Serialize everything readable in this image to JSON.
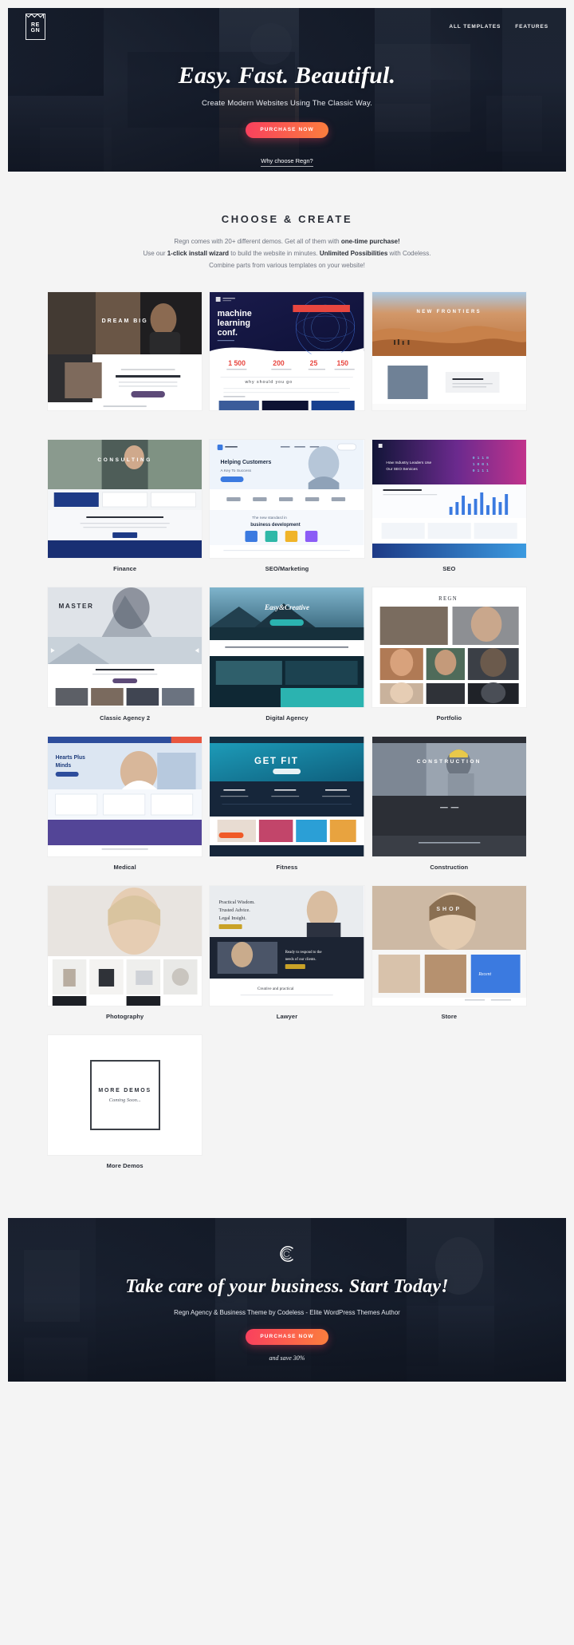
{
  "hero": {
    "logo": {
      "name": "regn-logo",
      "line1": "RE",
      "line2": "GN"
    },
    "nav": [
      {
        "label": "ALL TEMPLATES"
      },
      {
        "label": "FEATURES"
      }
    ],
    "title": "Easy. Fast. Beautiful.",
    "subtitle": "Create Modern Websites Using The Classic Way.",
    "cta_label": "PURCHASE NOW",
    "secondary_link": "Why choose Regn?",
    "accent_from": "#f9405e",
    "accent_to": "#fb7f3d",
    "overlay_color": "#111724"
  },
  "section": {
    "title": "CHOOSE & CREATE",
    "desc_line1_a": "Regn comes with 20+ different demos. Get all of them with ",
    "desc_line1_b": "one-time purchase!",
    "desc_line2_a": "Use our ",
    "desc_line2_b": "1-click install wizard",
    "desc_line2_c": " to build the website in minutes. ",
    "desc_line2_d": "Unlimited Possibilities",
    "desc_line2_e": " with Codeless.",
    "desc_line3": "Combine parts from various templates on your website!"
  },
  "templates": [
    {
      "label": "",
      "caption": "DREAM BIG",
      "style": "dream-big"
    },
    {
      "label": "",
      "caption": "machine learning conf.",
      "style": "ml-conf",
      "stats": [
        "1 500",
        "200",
        "25",
        "150"
      ],
      "note": "why should you go"
    },
    {
      "label": "",
      "caption": "NEW FRONTIERS",
      "style": "frontiers"
    },
    {
      "label": "Finance",
      "caption": "CONSULTING",
      "style": "finance"
    },
    {
      "label": "SEO/Marketing",
      "caption": "Helping Customers",
      "caption2": "A Key To Success",
      "caption3": "The new standard in",
      "caption4": "business development",
      "style": "seo-marketing"
    },
    {
      "label": "SEO",
      "caption": "How Industry Leaders Use Our SEO Services",
      "style": "seo"
    },
    {
      "label": "Classic Agency 2",
      "caption": "MASTER",
      "style": "classic-agency"
    },
    {
      "label": "Digital Agency",
      "caption": "Easy&Creative",
      "style": "digital-agency"
    },
    {
      "label": "Portfolio",
      "caption": "REGN",
      "style": "portfolio"
    },
    {
      "label": "Medical",
      "caption": "Hearts Plus Minds",
      "style": "medical"
    },
    {
      "label": "Fitness",
      "caption": "GET FIT",
      "style": "fitness"
    },
    {
      "label": "Construction",
      "caption": "CONSTRUCTION",
      "style": "construction"
    },
    {
      "label": "Photography",
      "caption": "",
      "style": "photography"
    },
    {
      "label": "Lawyer",
      "caption": "Practical Wisdom. Trusted Advice. Legal Insight.",
      "caption2": "Ready to respond to the needs of our clients.",
      "caption3": "Creative and practical",
      "style": "lawyer"
    },
    {
      "label": "Store",
      "caption": "SHOP",
      "style": "store"
    }
  ],
  "more_demos": {
    "box_title": "MORE DEMOS",
    "box_sub": "Coming Soon...",
    "label": "More Demos"
  },
  "cta": {
    "logo_name": "codeless-c-logo",
    "title": "Take care of your business. Start Today!",
    "subtitle": "Regn Agency & Business Theme by Codeless - Elite WordPress Themes Author",
    "button_label": "PURCHASE NOW",
    "save_note": "and save 30%"
  }
}
